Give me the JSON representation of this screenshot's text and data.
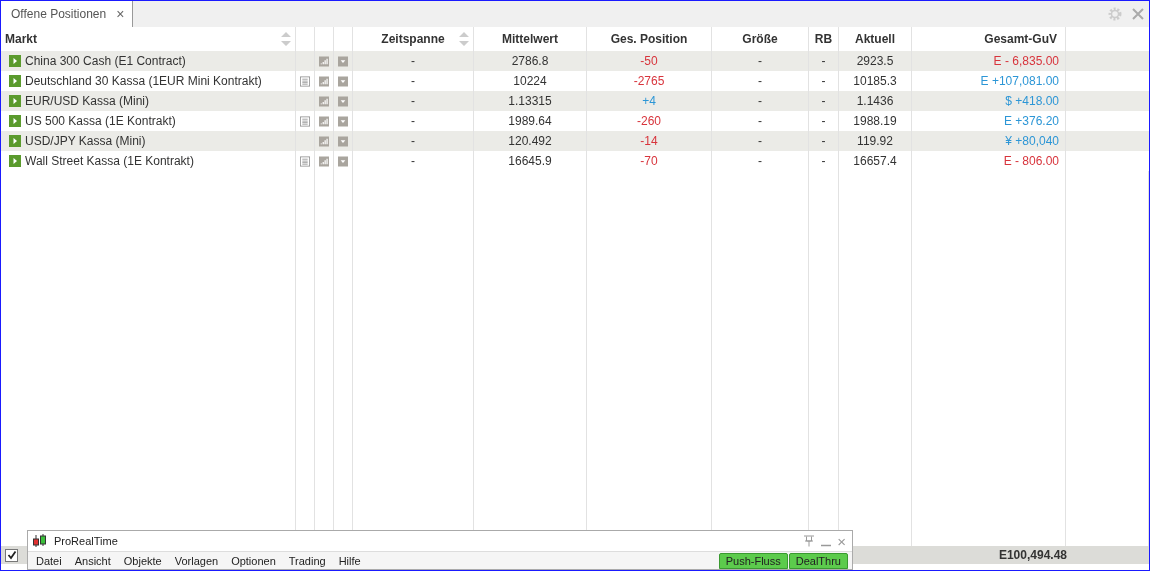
{
  "tabs": [
    {
      "label": "Offene Positionen",
      "close": "×",
      "selected": true
    }
  ],
  "table": {
    "columns": [
      {
        "label": "Markt",
        "sortable": true
      },
      {
        "sortable": false
      },
      {
        "sortable": false
      },
      {
        "sortable": false
      },
      {
        "label": "Zeitspanne",
        "sortable": true
      },
      {
        "label": "Mittelwert",
        "sortable": false
      },
      {
        "label": "Ges. Position",
        "sortable": false
      },
      {
        "label": "Größe",
        "sortable": false
      },
      {
        "label": "RB",
        "sortable": false
      },
      {
        "label": "Aktuell",
        "sortable": false
      },
      {
        "label": "Gesamt-GuV",
        "sortable": false
      }
    ],
    "rows": [
      {
        "market": "China 300 Cash (E1 Contract)",
        "news": false,
        "period": "-",
        "average": "2786.8",
        "position": {
          "text": "-50",
          "color": "#d8343c"
        },
        "size": "-",
        "rb": "-",
        "current": "2923.5",
        "pnl": {
          "text": "E - 6,835.00",
          "color": "#d8343c"
        }
      },
      {
        "market": "Deutschland 30 Kassa (1EUR Mini Kontrakt)",
        "news": true,
        "period": "-",
        "average": "10224",
        "position": {
          "text": "-2765",
          "color": "#d8343c"
        },
        "size": "-",
        "rb": "-",
        "current": "10185.3",
        "pnl": {
          "text": "E +107,081.00",
          "color": "#2c96d6"
        }
      },
      {
        "market": "EUR/USD Kassa (Mini)",
        "news": false,
        "period": "-",
        "average": "1.13315",
        "position": {
          "text": "+4",
          "color": "#2c96d6"
        },
        "size": "-",
        "rb": "-",
        "current": "1.1436",
        "pnl": {
          "text": "$ +418.00",
          "color": "#2c96d6"
        }
      },
      {
        "market": "US 500 Kassa (1E Kontrakt)",
        "news": true,
        "period": "-",
        "average": "1989.64",
        "position": {
          "text": "-260",
          "color": "#d8343c"
        },
        "size": "-",
        "rb": "-",
        "current": "1988.19",
        "pnl": {
          "text": "E +376.20",
          "color": "#2c96d6"
        }
      },
      {
        "market": "USD/JPY Kassa (Mini)",
        "news": false,
        "period": "-",
        "average": "120.492",
        "position": {
          "text": "-14",
          "color": "#d8343c"
        },
        "size": "-",
        "rb": "-",
        "current": "119.92",
        "pnl": {
          "text": "¥ +80,040",
          "color": "#2c96d6"
        }
      },
      {
        "market": "Wall Street Kassa (1E Kontrakt)",
        "news": true,
        "period": "-",
        "average": "16645.9",
        "position": {
          "text": "-70",
          "color": "#d8343c"
        },
        "size": "-",
        "rb": "-",
        "current": "16657.4",
        "pnl": {
          "text": "E - 806.00",
          "color": "#d8343c"
        }
      }
    ]
  },
  "footer": {
    "checked": true,
    "total": "E100,494.48"
  },
  "floating_window": {
    "title": "ProRealTime",
    "close": "×",
    "menu": [
      "Datei",
      "Ansicht",
      "Objekte",
      "Vorlagen",
      "Optionen",
      "Trading",
      "Hilfe"
    ],
    "buttons": [
      "Push-Fluss",
      "DealThru"
    ]
  }
}
